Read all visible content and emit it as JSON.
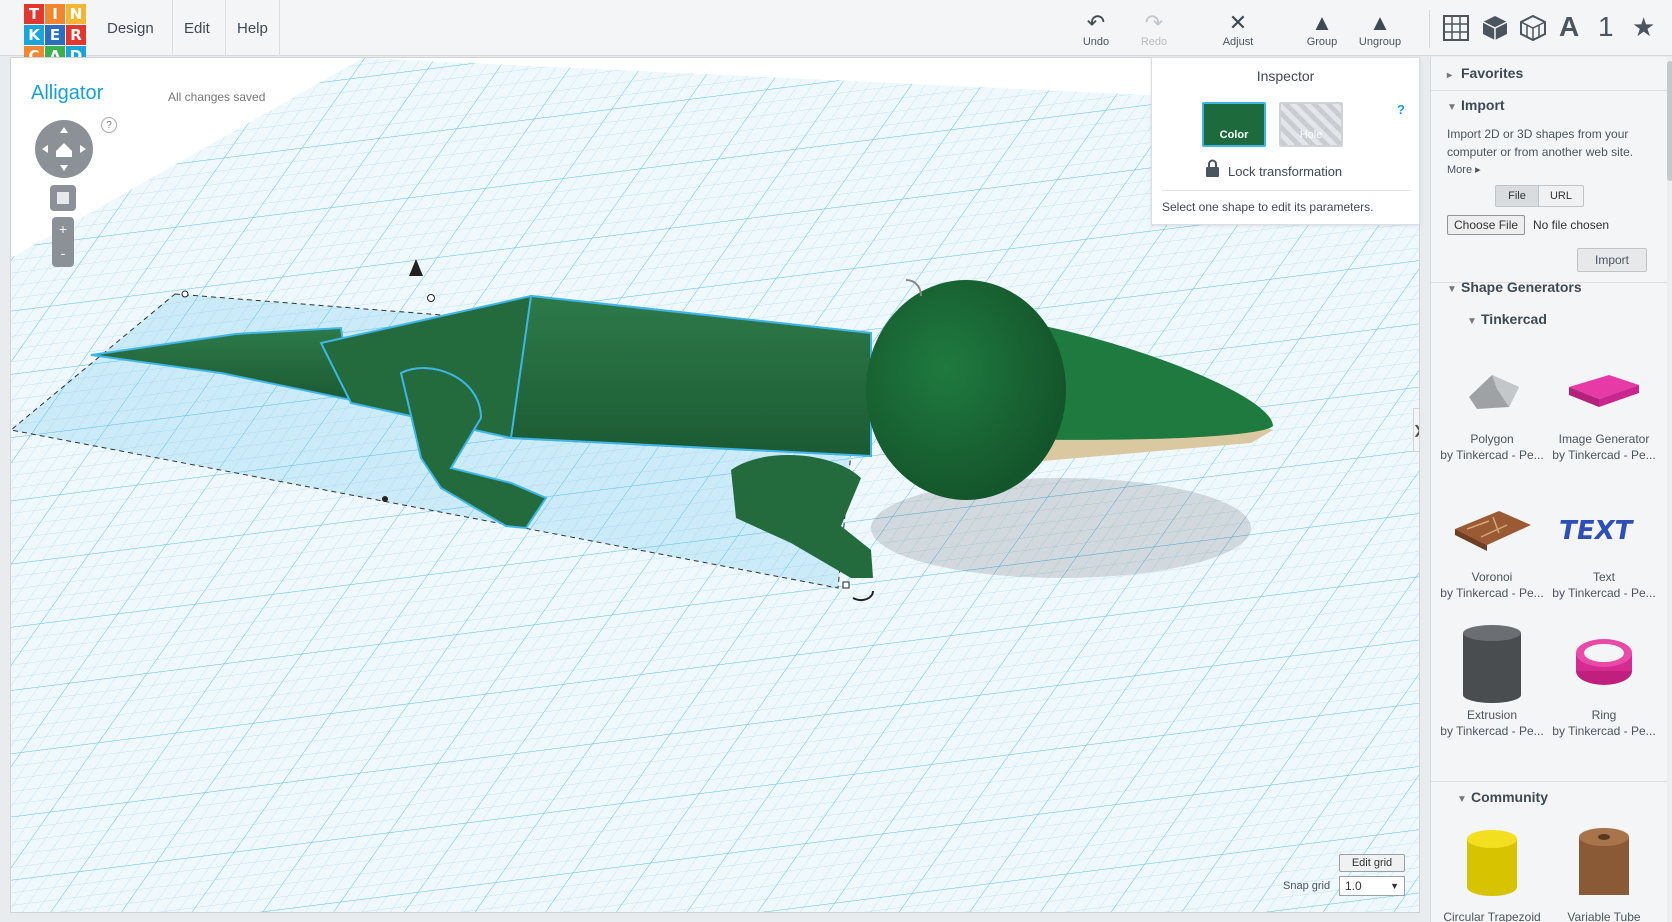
{
  "logo": {
    "letters": [
      "T",
      "I",
      "N",
      "K",
      "E",
      "R",
      "C",
      "A",
      "D"
    ],
    "colors": [
      "#e2372f",
      "#f0862f",
      "#f3b633",
      "#1ca3dc",
      "#2a6fc2",
      "#e2372f",
      "#f0862f",
      "#3bb04c",
      "#1ca3dc"
    ]
  },
  "menu": {
    "design": "Design",
    "edit": "Edit",
    "help": "Help"
  },
  "toolbar": {
    "undo": "Undo",
    "redo": "Redo",
    "adjust": "Adjust",
    "group": "Group",
    "ungroup": "Ungroup",
    "text_tool": "A",
    "number_tool": "1"
  },
  "design": {
    "title": "Alligator",
    "status": "All changes saved"
  },
  "view": {
    "help": "?",
    "zoom_in": "+",
    "zoom_out": "-"
  },
  "inspector": {
    "title": "Inspector",
    "color_label": "Color",
    "hole_label": "Hole",
    "help": "?",
    "lock_label": "Lock transformation",
    "note": "Select one shape to edit its parameters.",
    "selected_color": "#1d6b3c"
  },
  "panel": {
    "favorites": "Favorites",
    "import": {
      "title": "Import",
      "description": "Import 2D or 3D shapes from your computer or from another web site.",
      "more": "More",
      "file_tab": "File",
      "url_tab": "URL",
      "choose_file": "Choose File",
      "no_file": "No file chosen",
      "button": "Import"
    },
    "shape_generators": "Shape Generators",
    "tinkercad": "Tinkercad",
    "community": "Community",
    "shapes": [
      {
        "name": "Polygon",
        "by": "by Tinkercad - Pe..."
      },
      {
        "name": "Image Generator",
        "by": "by Tinkercad - Pe..."
      },
      {
        "name": "Voronoi",
        "by": "by Tinkercad - Pe..."
      },
      {
        "name": "Text",
        "by": "by Tinkercad - Pe..."
      },
      {
        "name": "Extrusion",
        "by": "by Tinkercad - Pe..."
      },
      {
        "name": "Ring",
        "by": "by Tinkercad - Pe..."
      }
    ],
    "community_shapes": [
      {
        "name": "Circular Trapezoid"
      },
      {
        "name": "Variable Tube"
      }
    ],
    "expand_arrow": "❯"
  },
  "grid": {
    "edit_label": "Edit grid",
    "snap_label": "Snap grid",
    "snap_value": "1.0"
  },
  "accent": "#1aa0d8"
}
